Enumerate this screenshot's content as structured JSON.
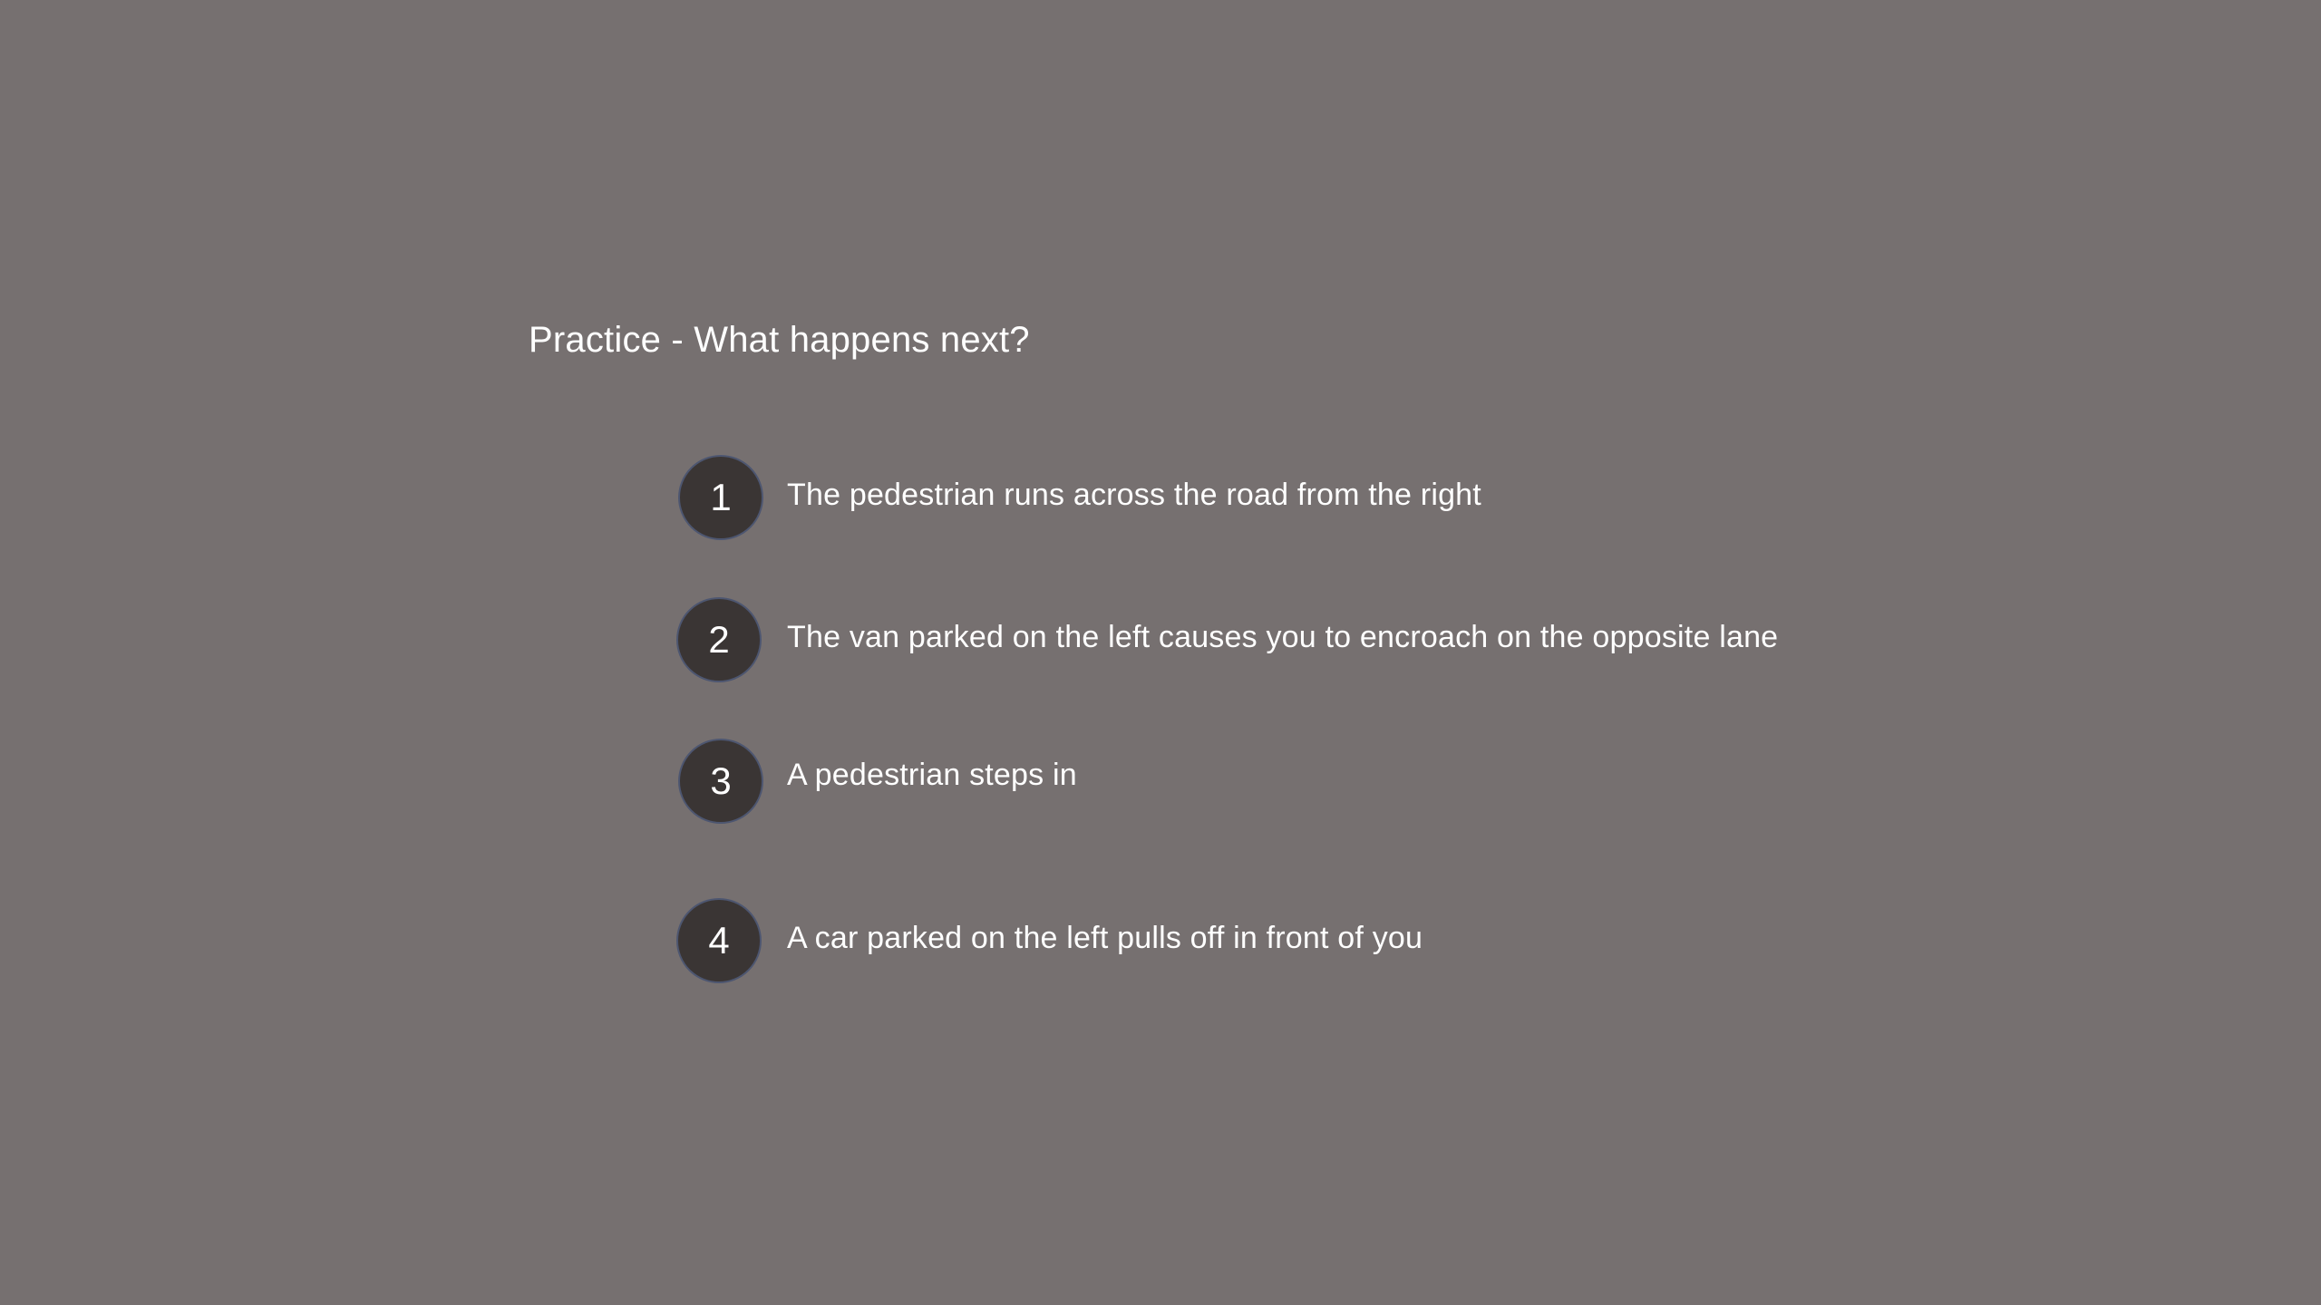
{
  "slide": {
    "title": "Practice - What happens next?",
    "options": [
      {
        "number": "1",
        "text": "The pedestrian runs across the road from the right"
      },
      {
        "number": "2",
        "text": "The van parked on the left causes you to encroach on the opposite lane"
      },
      {
        "number": "3",
        "text": "A pedestrian steps in"
      },
      {
        "number": "4",
        "text": "A car parked on the left pulls off in front of you"
      }
    ]
  },
  "colors": {
    "background": "#767070",
    "badge_fill": "#3a3534",
    "badge_border": "#4d5670",
    "text": "#ffffff"
  }
}
